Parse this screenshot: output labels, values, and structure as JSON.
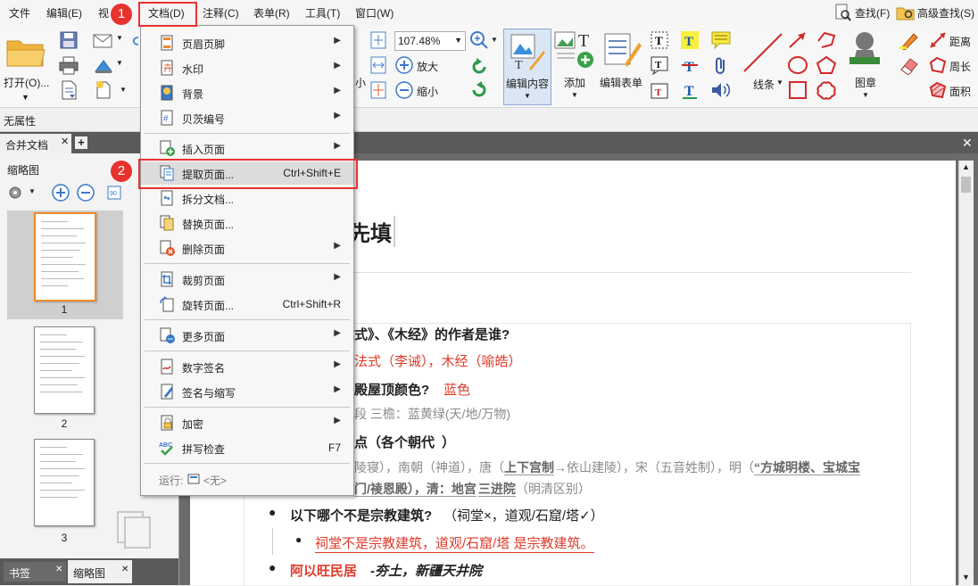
{
  "menubar": {
    "items": [
      "文件",
      "编辑(E)",
      "视",
      "文档(D)",
      "注释(C)",
      "表单(R)",
      "工具(T)",
      "窗口(W)"
    ],
    "find": "查找(F)",
    "advanced_find": "高级查找(S)"
  },
  "ribbon": {
    "open": "打开(O)...",
    "zoom_value": "107.48%",
    "zoom_in": "放大",
    "zoom_out": "缩小",
    "small": "小",
    "edit_content": "编辑内容",
    "add": "添加",
    "edit_form": "编辑表单",
    "line": "线条",
    "stamp": "图章",
    "distance": "距离",
    "perimeter": "周长",
    "area": "面积"
  },
  "props_bar": {
    "label": "无属性"
  },
  "doc_tabs": {
    "active": "合并文档"
  },
  "left_panel": {
    "title": "缩略图",
    "thumb_numbers": [
      "1",
      "2",
      "3"
    ],
    "bottom_tabs": [
      "书签",
      "缩略图"
    ]
  },
  "document": {
    "heading_fragment": "先填",
    "q1": "式》、《木经》的作者是谁?",
    "a1": "法式（李诫），木经（喻皓）",
    "q2_a": "殿屋顶颜色?",
    "q2_b": "蓝色",
    "n2": "段 三檐：蓝黄绿(天/地/万物)",
    "q3": "点（各个朝代",
    "q3_close": "）",
    "n3a": "陵寝），南朝（神道），唐（",
    "n3b": "上下宫制",
    "n3c": "→依山建陵），宋（五音姓制），明（",
    "n3d": "“方城明楼、宝城宝",
    "n3e": "门/祾恩殿），清：地宫",
    "n3f": "三进院",
    "n3g": "（明清区别）",
    "q4": "以下哪个不是宗教建筑?",
    "q4_note": "（祠堂×，道观/石窟/塔✓）",
    "a4": "祠堂不是宗教建筑，道观/石窟/塔 是宗教建筑。",
    "q5_red": "阿以旺民居",
    "q5_rest": "-夯土，新疆天井院"
  },
  "doc_menu": {
    "items": [
      {
        "label": "页眉页脚",
        "shortcut": "",
        "submenu": true
      },
      {
        "label": "水印",
        "shortcut": "",
        "submenu": true
      },
      {
        "label": "背景",
        "shortcut": "",
        "submenu": true
      },
      {
        "label": "贝茨编号",
        "shortcut": "",
        "submenu": true
      },
      {
        "label": "插入页面",
        "shortcut": "",
        "submenu": true
      },
      {
        "label": "提取页面...",
        "shortcut": "Ctrl+Shift+E",
        "submenu": false
      },
      {
        "label": "拆分文档...",
        "shortcut": "",
        "submenu": false
      },
      {
        "label": "替换页面...",
        "shortcut": "",
        "submenu": false
      },
      {
        "label": "删除页面",
        "shortcut": "",
        "submenu": true
      },
      {
        "label": "裁剪页面",
        "shortcut": "",
        "submenu": true
      },
      {
        "label": "旋转页面...",
        "shortcut": "Ctrl+Shift+R",
        "submenu": false
      },
      {
        "label": "更多页面",
        "shortcut": "",
        "submenu": true
      },
      {
        "label": "数字签名",
        "shortcut": "",
        "submenu": true
      },
      {
        "label": "签名与缩写",
        "shortcut": "",
        "submenu": true
      },
      {
        "label": "加密",
        "shortcut": "",
        "submenu": true
      },
      {
        "label": "拼写检查",
        "shortcut": "F7",
        "submenu": false
      }
    ],
    "run_label": "运行:",
    "run_value": "<无>"
  },
  "annotations": {
    "badge1": "1",
    "badge2": "2"
  },
  "colors": {
    "accent_red": "#e8322d",
    "menu_hover": "#dcdcdc",
    "doc_red": "#e03a2a"
  }
}
